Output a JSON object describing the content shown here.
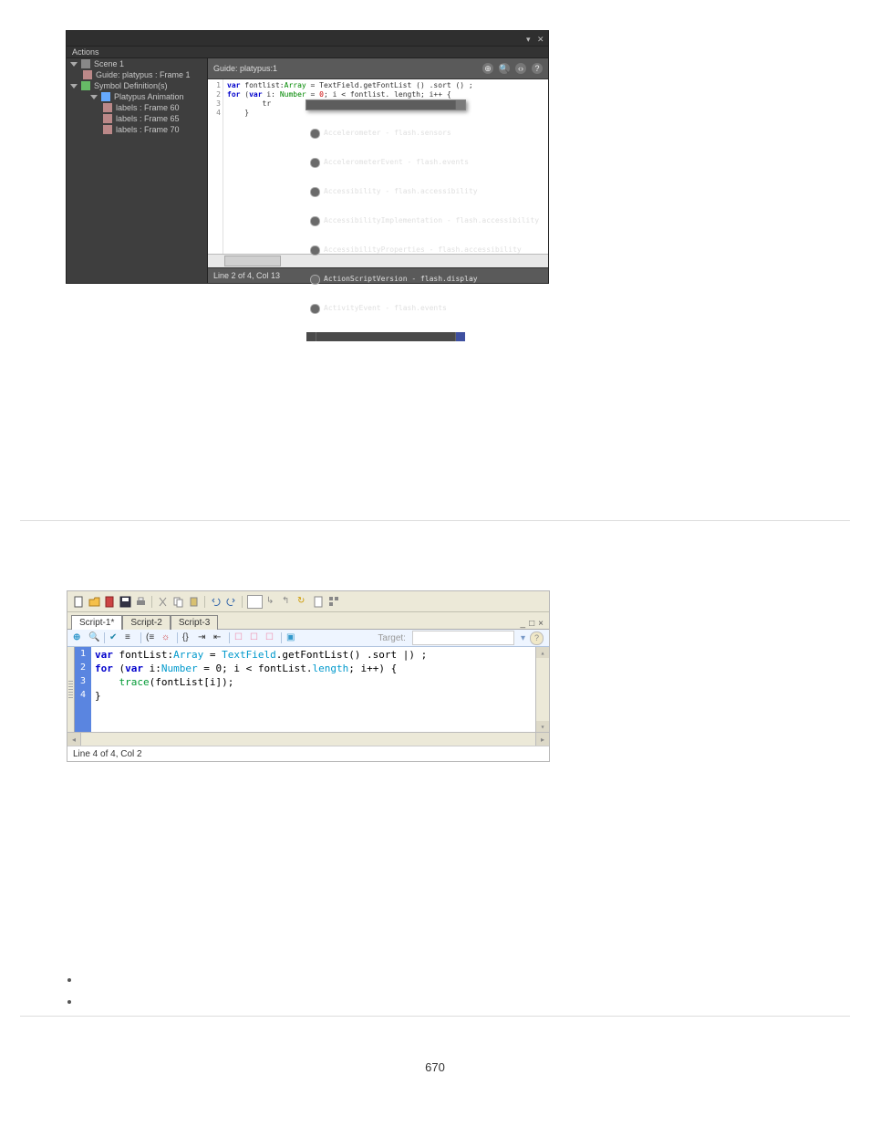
{
  "page_number": "670",
  "figure1": {
    "titlebar_left": "",
    "subheader": "Actions",
    "tree": {
      "scene": "Scene 1",
      "guide": "Guide: platypus : Frame 1",
      "symdefs": "Symbol Definition(s)",
      "anim": "Platypus Animation",
      "frames": [
        "labels : Frame 60",
        "labels : Frame 65",
        "labels : Frame 70"
      ]
    },
    "editor_header_left": "Guide: platypus:1",
    "code_lines": {
      "l1": "var fontlist:Array = TextField.getFontList () .sort () ;",
      "l2": "for (var i: Number = 0; i < fontlist. length; i++ {",
      "l3": "        tr",
      "l4": "    }"
    },
    "autocomplete": [
      "Accelerometer - flash.sensors",
      "AccelerometerEvent - flash.events",
      "Accessibility - flash.accessibility",
      "AccessibilityImplementation - flash.accessibility",
      "AccessibilityProperties - flash.accessibility",
      "ActionScriptVersion - flash.display",
      "ActivityEvent - flash.events"
    ],
    "status": "Line 2 of 4, Col 13"
  },
  "figure2": {
    "tabs": [
      "Script-1*",
      "Script-2",
      "Script-3"
    ],
    "target_label": "Target:",
    "code_lines": {
      "l1": "var fontList:Array = TextField.getFontList() .sort |) ;",
      "l2": "for (var i:Number = 0; i < fontList.length; i++) {",
      "l3": "    trace(fontList[i]);",
      "l4": "}"
    },
    "status": "Line 4 of 4, Col 2"
  }
}
